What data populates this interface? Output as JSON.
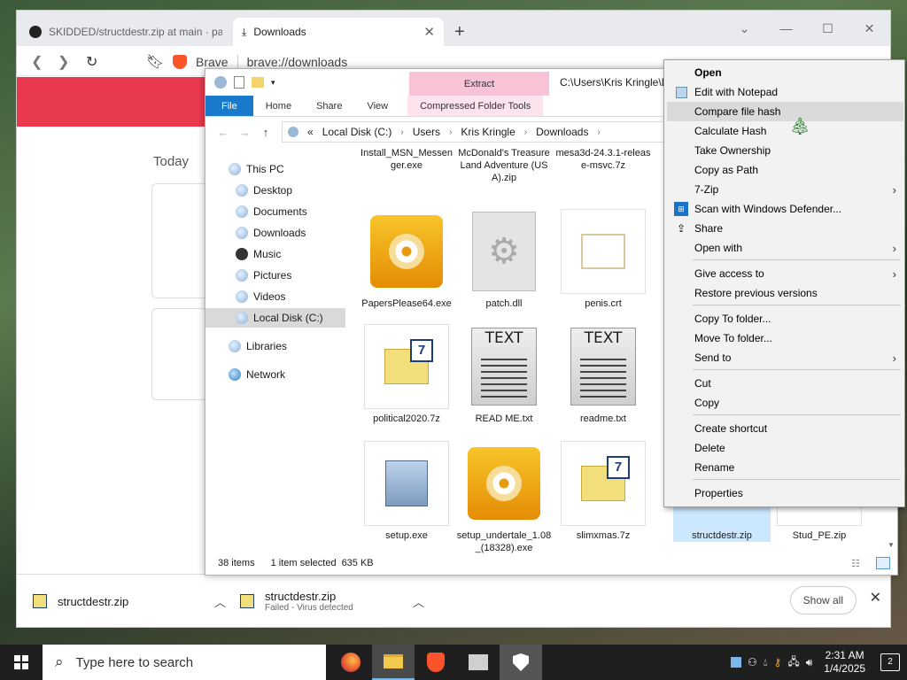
{
  "browser": {
    "tabs": [
      {
        "label": "SKIDDED/structdestr.zip at main · par"
      },
      {
        "label": "Downloads"
      }
    ],
    "brand": "Brave",
    "url": "brave://downloads",
    "today_label": "Today",
    "download_bar": {
      "items": [
        {
          "name": "structdestr.zip",
          "status": ""
        },
        {
          "name": "structdestr.zip",
          "status": "Failed - Virus detected"
        }
      ],
      "show_all": "Show all"
    }
  },
  "explorer": {
    "extract_tab": "Extract",
    "title_path": "C:\\Users\\Kris Kringle\\D",
    "ribbon_tabs": [
      "File",
      "Home",
      "Share",
      "View",
      "Compressed Folder Tools"
    ],
    "breadcrumb": [
      "«",
      "Local Disk (C:)",
      "Users",
      "Kris Kringle",
      "Downloads"
    ],
    "nav": [
      {
        "label": "This PC"
      },
      {
        "label": "Desktop"
      },
      {
        "label": "Documents"
      },
      {
        "label": "Downloads"
      },
      {
        "label": "Music"
      },
      {
        "label": "Pictures"
      },
      {
        "label": "Videos"
      },
      {
        "label": "Local Disk (C:)"
      },
      {
        "label": "Libraries"
      },
      {
        "label": "Network"
      }
    ],
    "files": [
      {
        "name": "Install_MSN_Messenger.exe",
        "icon": "none"
      },
      {
        "name": "McDonald's Treasure Land Adventure (USA).zip",
        "icon": "none"
      },
      {
        "name": "mesa3d-24.3.1-release-msvc.7z",
        "icon": "none"
      },
      {
        "name": "PapersPlease64.exe",
        "icon": "disc-icon"
      },
      {
        "name": "patch.dll",
        "icon": "dll-gear-icon"
      },
      {
        "name": "penis.crt",
        "icon": "certificate-icon"
      },
      {
        "name": "political2020.7z",
        "icon": "7z-archive-icon"
      },
      {
        "name": "READ ME.txt",
        "icon": "text-document-icon"
      },
      {
        "name": "readme.txt",
        "icon": "text-document-icon"
      },
      {
        "name": "setup.exe",
        "icon": "setup-installer-icon"
      },
      {
        "name": "setup_undertale_1.08_(18328).exe",
        "icon": "disc-icon"
      },
      {
        "name": "slimxmas.7z",
        "icon": "7z-archive-icon"
      },
      {
        "name": "structdestr.zip",
        "icon": "zip-icon"
      },
      {
        "name": "Stud_PE.zip",
        "icon": "zip-icon"
      }
    ],
    "status": {
      "count": "38 items",
      "selection": "1 item selected",
      "size": "635 KB"
    },
    "textdoc_label": "TEXT"
  },
  "context_menu": {
    "items": [
      {
        "label": "Open"
      },
      {
        "label": "Edit with Notepad"
      },
      {
        "label": "Compare file hash"
      },
      {
        "label": "Calculate Hash"
      },
      {
        "label": "Take Ownership"
      },
      {
        "label": "Copy as Path"
      },
      {
        "label": "7-Zip"
      },
      {
        "label": "Scan with Windows Defender..."
      },
      {
        "label": "Share"
      },
      {
        "label": "Open with"
      },
      {
        "label": "Give access to"
      },
      {
        "label": "Restore previous versions"
      },
      {
        "label": "Copy To folder..."
      },
      {
        "label": "Move To folder..."
      },
      {
        "label": "Send to"
      },
      {
        "label": "Cut"
      },
      {
        "label": "Copy"
      },
      {
        "label": "Create shortcut"
      },
      {
        "label": "Delete"
      },
      {
        "label": "Rename"
      },
      {
        "label": "Properties"
      }
    ]
  },
  "taskbar": {
    "search_placeholder": "Type here to search",
    "time": "2:31 AM",
    "date": "1/4/2025",
    "notifications": "2"
  },
  "colors": {
    "accent": "#1979ca",
    "brave_banner": "#e8394f",
    "extract_tab": "#f8c3d7",
    "selection": "#cce8ff"
  }
}
